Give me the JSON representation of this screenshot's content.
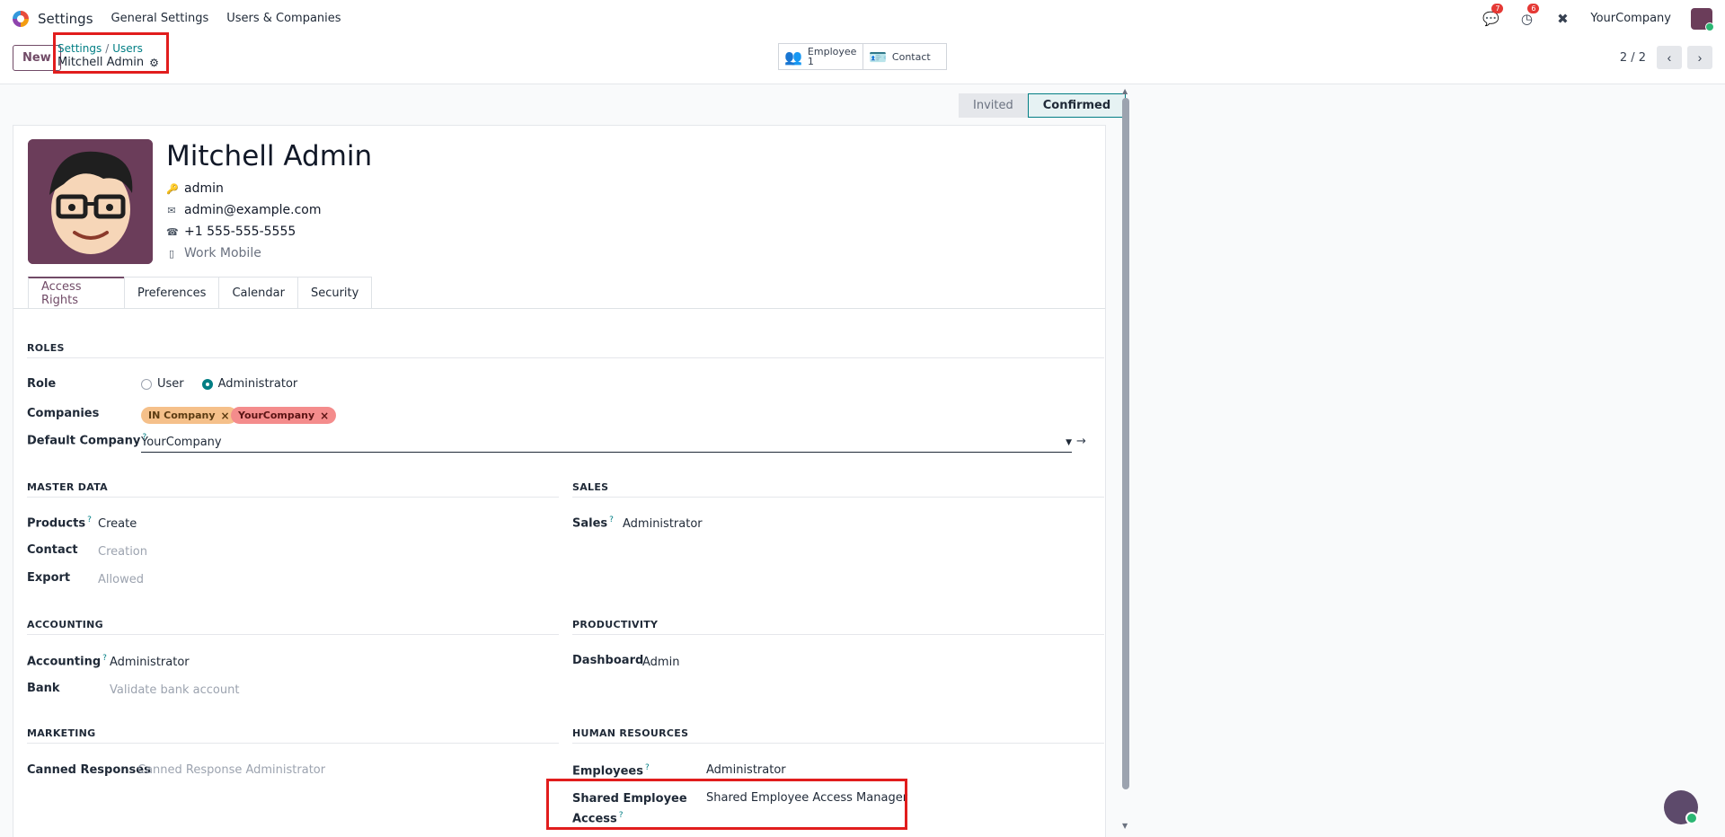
{
  "navbar": {
    "app_name": "Settings",
    "menus": [
      "General Settings",
      "Users & Companies"
    ],
    "messages_badge": "7",
    "activities_badge": "6",
    "company": "YourCompany"
  },
  "control_panel": {
    "new_label": "New",
    "breadcrumb": [
      "Settings",
      "Users"
    ],
    "record_title": "Mitchell Admin",
    "smart_buttons": {
      "employee_label": "Employee",
      "employee_count": "1",
      "contact_label": "Contact"
    },
    "pager": "2 / 2"
  },
  "status": {
    "steps": [
      "Invited",
      "Confirmed"
    ],
    "active": "Confirmed"
  },
  "user": {
    "name": "Mitchell Admin",
    "login": "admin",
    "email": "admin@example.com",
    "phone": "+1 555-555-5555",
    "mobile_placeholder": "Work Mobile"
  },
  "tabs": [
    "Access Rights",
    "Preferences",
    "Calendar",
    "Security"
  ],
  "roles": {
    "title": "ROLES",
    "role_label": "Role",
    "role_options": [
      "User",
      "Administrator"
    ],
    "companies_label": "Companies",
    "companies": [
      "IN Company",
      "YourCompany"
    ],
    "default_company_label": "Default Company",
    "default_company": "YourCompany"
  },
  "master_data": {
    "title": "MASTER DATA",
    "products_label": "Products",
    "products_value": "Create",
    "contact_label": "Contact",
    "contact_value": "Creation",
    "export_label": "Export",
    "export_value": "Allowed"
  },
  "sales": {
    "title": "SALES",
    "sales_label": "Sales",
    "sales_value": "Administrator"
  },
  "accounting": {
    "title": "ACCOUNTING",
    "accounting_label": "Accounting",
    "accounting_value": "Administrator",
    "bank_label": "Bank",
    "bank_value": "Validate bank account"
  },
  "productivity": {
    "title": "PRODUCTIVITY",
    "dashboard_label": "Dashboard",
    "dashboard_value": "Admin"
  },
  "marketing": {
    "title": "MARKETING",
    "canned_label": "Canned Responses",
    "canned_value": "Canned Response Administrator"
  },
  "hr": {
    "title": "HUMAN RESOURCES",
    "employees_label": "Employees",
    "employees_value": "Administrator",
    "shared_label_1": "Shared Employee",
    "shared_label_2": "Access",
    "shared_value": "Shared Employee Access Manager"
  },
  "colors": {
    "brand": "#714b67",
    "accent": "#017e84",
    "highlight": "#e11d1d",
    "tag_in_company": "#f5c08a",
    "tag_yourcompany": "#f48c8c"
  }
}
